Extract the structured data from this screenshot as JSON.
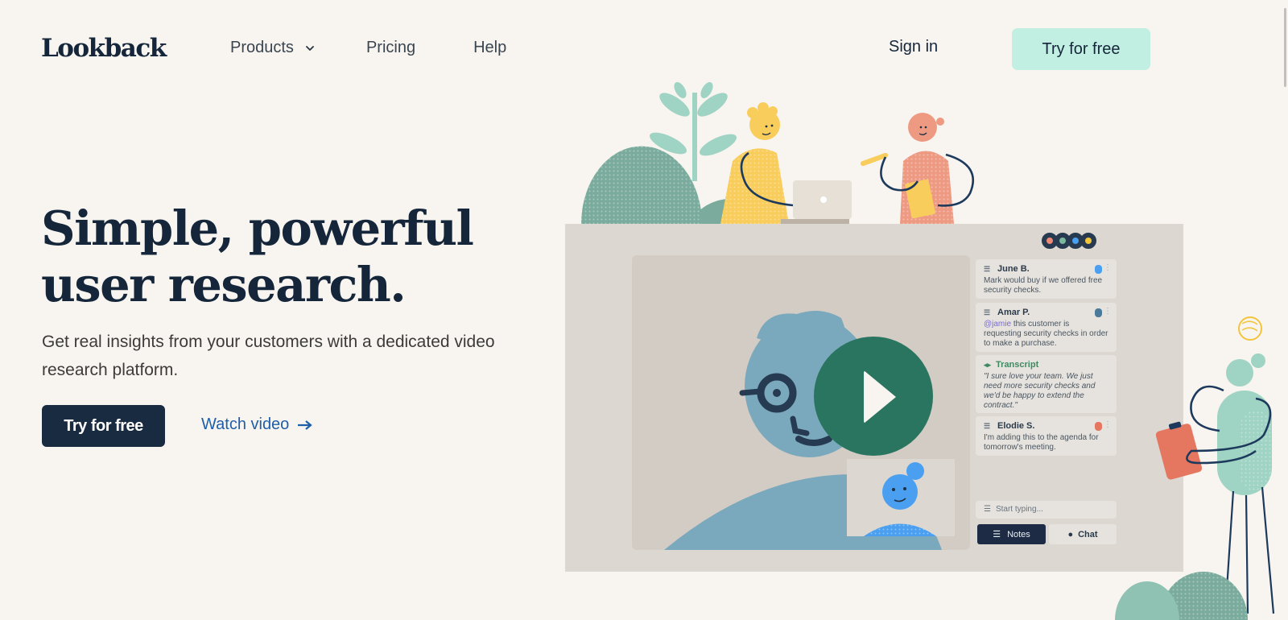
{
  "header": {
    "logo": "Lookback",
    "nav": [
      {
        "label": "Products",
        "has_dropdown": true
      },
      {
        "label": "Pricing"
      },
      {
        "label": "Help"
      }
    ],
    "sign_in": "Sign in",
    "cta": "Try for free"
  },
  "hero": {
    "headline_line1": "Simple, powerful",
    "headline_line2": "user research.",
    "subtitle": "Get real insights from your customers with a dedicated video research platform.",
    "primary_cta": "Try for free",
    "secondary_cta": "Watch video",
    "secondary_icon": "arrow-right-icon"
  },
  "illustration": {
    "notes": [
      {
        "author": "June B.",
        "text": "Mark would buy if we offered free security checks."
      },
      {
        "author": "Amar P.",
        "mention": "@jamie",
        "text": " this customer is requesting security checks in order to make a purchase."
      },
      {
        "type": "transcript",
        "title": "Transcript",
        "text": "\"I sure love your team. We just need more security checks and we'd be happy to extend the contract.\""
      },
      {
        "author": "Elodie S.",
        "text": "I'm adding this to the agenda for tomorrow's meeting."
      }
    ],
    "input_placeholder": "Start typing...",
    "tabs": [
      {
        "label": "Notes",
        "active": true
      },
      {
        "label": "Chat",
        "active": false
      }
    ]
  },
  "colors": {
    "background": "#f8f5f1",
    "navy": "#15263a",
    "mint_button": "#c1efe2",
    "link_blue": "#1f5ea8",
    "play_green": "#2a7560"
  }
}
